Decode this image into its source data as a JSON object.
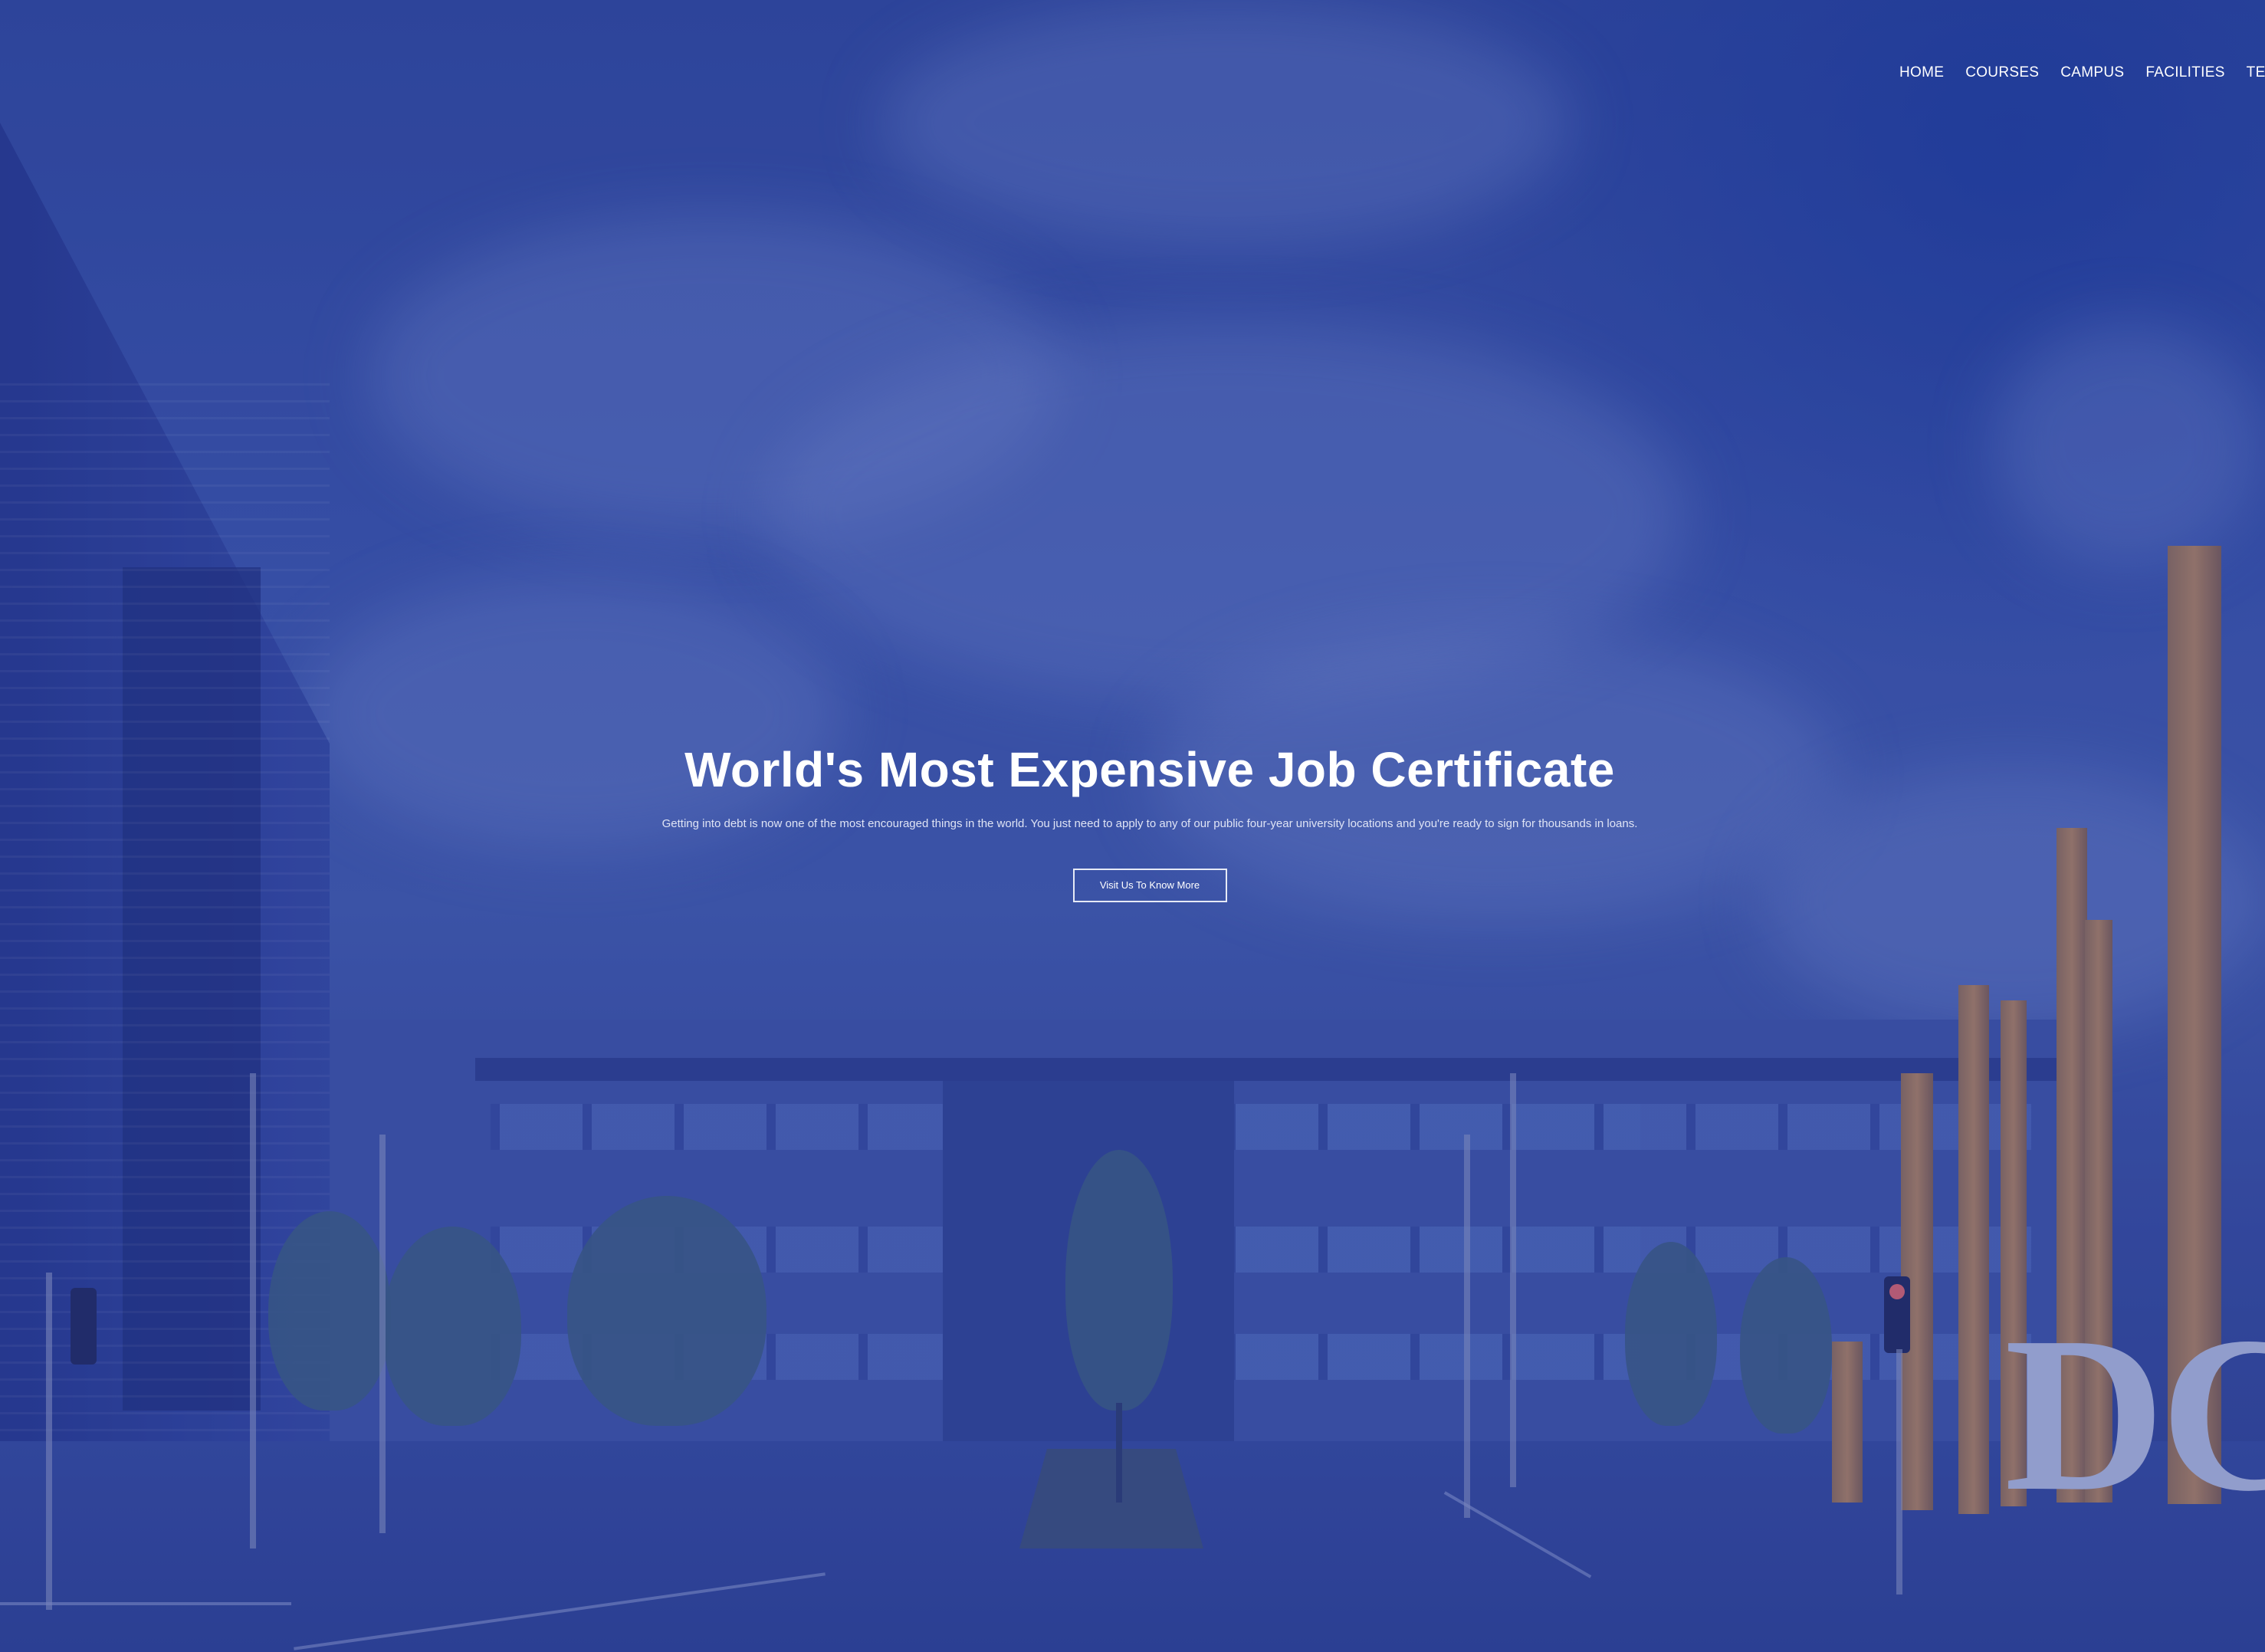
{
  "nav": {
    "items": [
      "HOME",
      "COURSES",
      "CAMPUS",
      "FACILITIES",
      "TESTIMO"
    ]
  },
  "hero": {
    "title": "World's Most Expensive Job Certificate",
    "subtitle": "Getting into debt is now one of the most encouraged things in the world. You just need to apply to any of our public four-year university locations and you're ready to sign for thousands in loans.",
    "cta_label": "Visit Us To Know More"
  },
  "background": {
    "sculpture_letters": "DC",
    "overlay_color": "#2f4699"
  }
}
